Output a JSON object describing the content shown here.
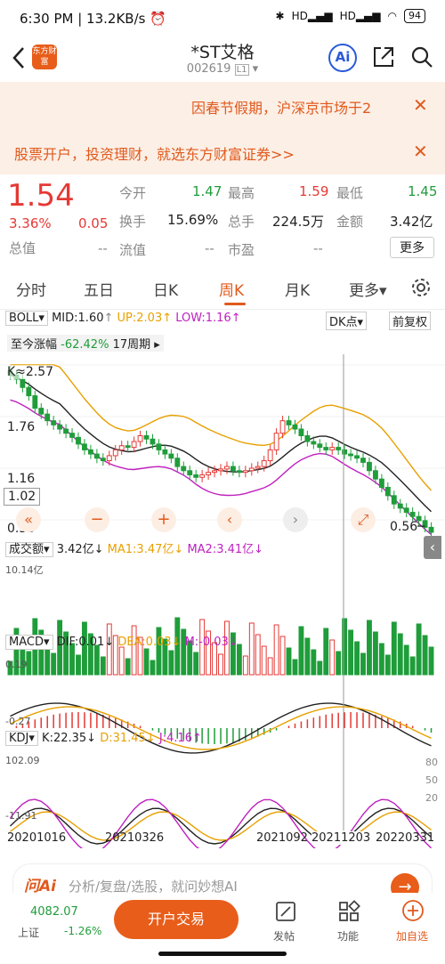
{
  "status": {
    "time": "6:30 PM",
    "speed": "13.2KB/s",
    "battery": "94",
    "net1": "HD",
    "net2": "HD"
  },
  "header": {
    "title": "*ST艾格",
    "code": "002619",
    "tag": "L1",
    "logo": "东方财富",
    "ai": "Ai"
  },
  "notice": {
    "text": "因春节假期，沪深京市场于2"
  },
  "ad": {
    "text": "股票开户，投资理财，就选东方财富证券>>"
  },
  "quote": {
    "price": "1.54",
    "pct": "3.36%",
    "chg": "0.05",
    "open_label": "今开",
    "open": "1.47",
    "high_label": "最高",
    "high": "1.59",
    "low_label": "最低",
    "low": "1.45",
    "turnover_label": "换手",
    "turnover": "15.69%",
    "volume_label": "总手",
    "volume": "224.5万",
    "amount_label": "金额",
    "amount": "3.42亿",
    "mktcap_label": "总值",
    "mktcap": "--",
    "float_label": "流值",
    "float": "--",
    "pe_label": "市盈",
    "pe": "--",
    "more": "更多"
  },
  "tabs": [
    "分时",
    "五日",
    "日K",
    "周K",
    "月K",
    "更多▾"
  ],
  "chart": {
    "indicator": "BOLL",
    "mid": "MID:1.60",
    "up": "UP:2.03",
    "low": "LOW:1.16",
    "dk": "DK点",
    "adjust": "前复权",
    "since": "至今涨幅",
    "since_pct": "-62.42%",
    "since_weeks": "17周期",
    "y_top": "2.57",
    "y1": "1.76",
    "y2": "1.16",
    "y_cur": "1.02",
    "y_bot": "0.56",
    "y_min": "0.56",
    "vol_label": "成交额",
    "vol_val": "3.42亿",
    "vol_ma1": "MA1:3.47亿",
    "vol_ma2": "MA2:3.41亿",
    "vol_max": "10.14亿",
    "macd_label": "MACD",
    "dif": "DIF:0.01",
    "dea": "DEA:0.03",
    "m": "M:-0.03",
    "macd_top": "0.19",
    "macd_bot": "-0.27",
    "kdj_label": "KDJ",
    "k": "K:22.35",
    "d": "D:31.45",
    "j": "J:4.16",
    "kdj_top": "102.09",
    "kdj_bot": "-11.91",
    "kdj_80": "80",
    "kdj_50": "50",
    "kdj_20": "20",
    "dates": [
      "20201016",
      "20210326",
      "2021092",
      "20211203",
      "20220331"
    ]
  },
  "ai_bar": {
    "brand": "问Ai",
    "placeholder": "分析/复盘/选股，就问妙想AI"
  },
  "bottom": {
    "index_val": "4082.07",
    "index_name": "上证",
    "index_pct": "-1.26%",
    "trade": "开户交易",
    "post": "发帖",
    "func": "功能",
    "watch": "加自选"
  },
  "chart_data": {
    "type": "candlestick",
    "title": "",
    "series": [
      {
        "name": "BOLL MID"
      },
      {
        "name": "BOLL UP"
      },
      {
        "name": "BOLL LOW"
      }
    ],
    "ylim": [
      0.56,
      2.57
    ],
    "close": [
      2.45,
      2.4,
      2.3,
      2.2,
      2.05,
      1.98,
      1.9,
      1.85,
      1.8,
      1.75,
      1.7,
      1.62,
      1.55,
      1.5,
      1.45,
      1.42,
      1.48,
      1.55,
      1.6,
      1.58,
      1.65,
      1.72,
      1.68,
      1.62,
      1.55,
      1.5,
      1.45,
      1.35,
      1.3,
      1.25,
      1.22,
      1.25,
      1.28,
      1.3,
      1.32,
      1.35,
      1.3,
      1.28,
      1.3,
      1.33,
      1.35,
      1.42,
      1.55,
      1.75,
      1.9,
      1.85,
      1.8,
      1.72,
      1.65,
      1.62,
      1.58,
      1.55,
      1.58,
      1.55,
      1.5,
      1.48,
      1.45,
      1.4,
      1.3,
      1.2,
      1.1,
      1.0,
      0.9,
      0.85,
      0.8,
      0.75,
      0.7,
      0.62,
      0.56
    ]
  }
}
